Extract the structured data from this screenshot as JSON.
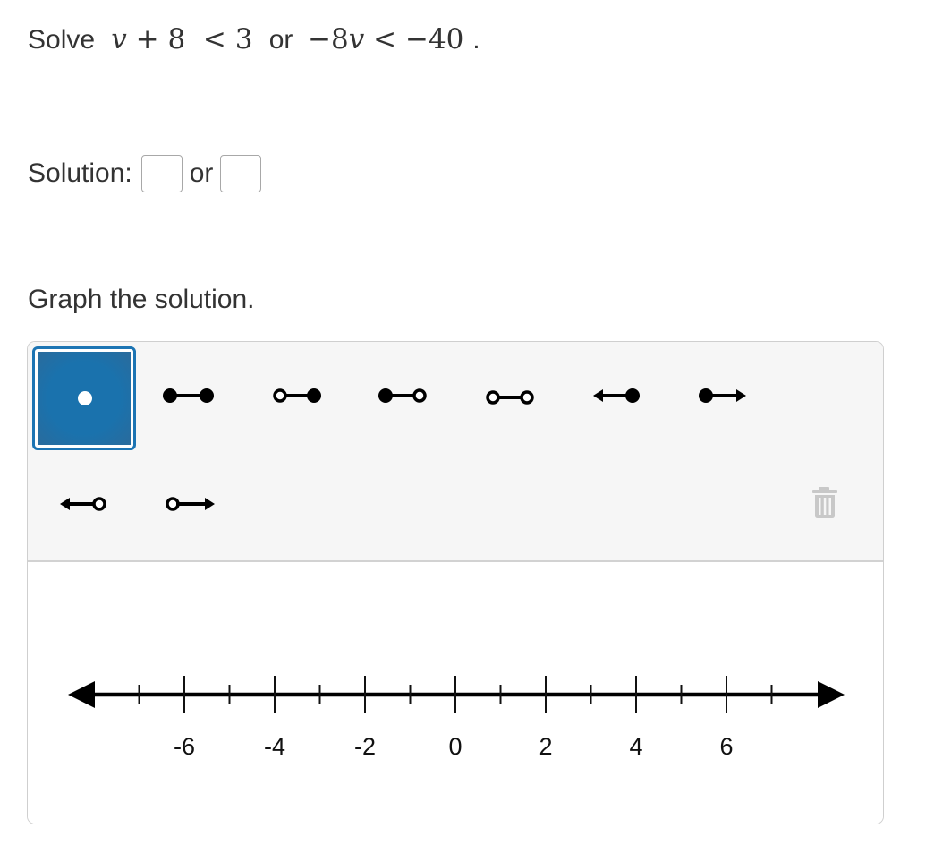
{
  "problem": {
    "prefix": "Solve",
    "inequality1": {
      "var": "v",
      "op1": "+",
      "num1": "8",
      "rel": "<",
      "num2": "3"
    },
    "connector": "or",
    "inequality2": {
      "coef": "−8",
      "var": "v",
      "rel": "<",
      "num": "−40"
    },
    "suffix": "."
  },
  "solution": {
    "label": "Solution:",
    "connector": "or",
    "answer1_value": "",
    "answer2_value": ""
  },
  "prompt": "Graph the solution.",
  "toolbar": {
    "tools": [
      {
        "id": "point",
        "label": "point-icon",
        "selected": true
      },
      {
        "id": "closed-closed",
        "label": "segment-closed-closed-icon",
        "selected": false
      },
      {
        "id": "open-closed",
        "label": "segment-open-closed-icon",
        "selected": false
      },
      {
        "id": "closed-open",
        "label": "segment-closed-open-icon",
        "selected": false
      },
      {
        "id": "open-open",
        "label": "segment-open-open-icon",
        "selected": false
      },
      {
        "id": "ray-left-closed",
        "label": "ray-left-closed-icon",
        "selected": false
      },
      {
        "id": "ray-right-closed",
        "label": "ray-right-closed-icon",
        "selected": false
      },
      {
        "id": "ray-left-open",
        "label": "ray-left-open-icon",
        "selected": false
      },
      {
        "id": "ray-right-open",
        "label": "ray-right-open-icon",
        "selected": false
      }
    ],
    "delete_icon": "trash-icon",
    "accent_color": "#1c74b3"
  },
  "number_line": {
    "min": -8,
    "max": 8,
    "major_ticks": [
      -6,
      -4,
      -2,
      0,
      2,
      4,
      6
    ],
    "minor_ticks": [
      -7,
      -5,
      -3,
      -1,
      1,
      3,
      5,
      7
    ],
    "labels": [
      "-6",
      "-4",
      "-2",
      "0",
      "2",
      "4",
      "6"
    ]
  }
}
